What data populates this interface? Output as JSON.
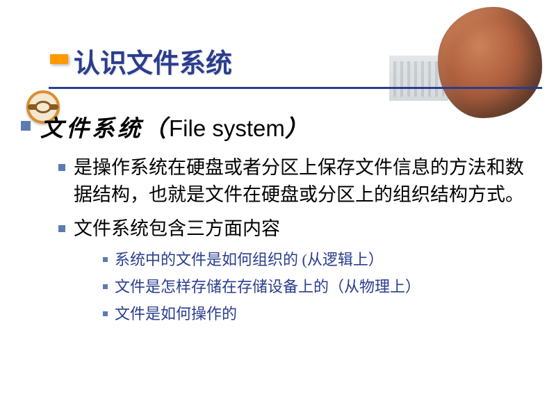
{
  "slide": {
    "title": "认识文件系统",
    "heading": {
      "cn": "文件系统（",
      "en": "File system",
      "close": "）"
    },
    "points_l2": [
      "是操作系统在硬盘或者分区上保存文件信息的方法和数据结构，也就是文件在硬盘或分区上的组织结构方式。",
      "文件系统包含三方面内容"
    ],
    "points_l3": [
      "系统中的文件是如何组织的 (从逻辑上）",
      "文件是怎样存储在存储设备上的（从物理上）",
      "文件是如何操作的"
    ]
  }
}
